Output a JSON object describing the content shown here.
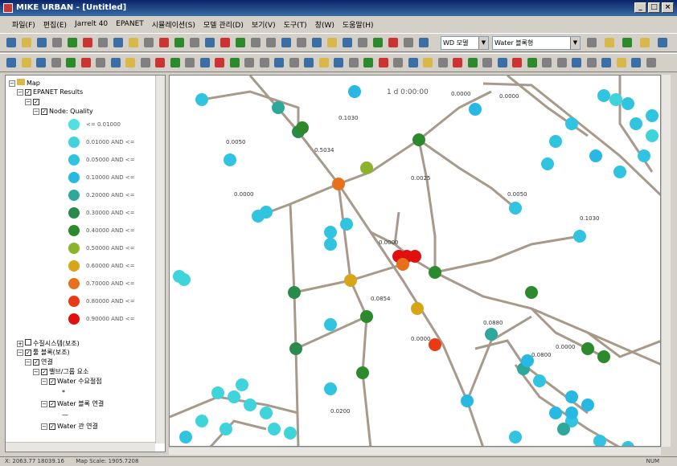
{
  "window": {
    "title": "MIKE URBAN - [Untitled]"
  },
  "menu": [
    "파일(F)",
    "편집(E)",
    "Jarrelt 40",
    "EPANET",
    "시뮬레이션(S)",
    "모델 관리(D)",
    "보기(V)",
    "도구(T)",
    "창(W)",
    "도움말(H)"
  ],
  "toolbar": {
    "combo1": "WD 모델",
    "combo2": "Water 블록형"
  },
  "tree": {
    "root": "Map",
    "results": "EPANET Results",
    "subgroup": "",
    "node_label": "Node: Quality",
    "legend": [
      {
        "label": "<= 0.01000",
        "color": "#4fe0e0"
      },
      {
        "label": "0.01000 AND <=",
        "color": "#3fd4dc"
      },
      {
        "label": "0.05000 AND <=",
        "color": "#30c4e0"
      },
      {
        "label": "0.10000 AND <=",
        "color": "#27b8e4"
      },
      {
        "label": "0.20000 AND <=",
        "color": "#2da89a"
      },
      {
        "label": "0.30000 AND <=",
        "color": "#2a8a4a"
      },
      {
        "label": "0.40000 AND <=",
        "color": "#2c8a2c"
      },
      {
        "label": "0.50000 AND <=",
        "color": "#8cb42a"
      },
      {
        "label": "0.60000 AND <=",
        "color": "#d8a418"
      },
      {
        "label": "0.70000 AND <=",
        "color": "#e8701a"
      },
      {
        "label": "0.80000 AND <=",
        "color": "#e83a14"
      },
      {
        "label": "0.90000 AND <=",
        "color": "#e01010"
      }
    ],
    "group2": "수질시스템(보조)",
    "group3": "툴 블록(보조)",
    "group4": "연결",
    "group5": "밸브/그룹 요소",
    "item1": "Water 수요절점",
    "item2": "Water 블록 연결",
    "item3": "Water 관 연결",
    "star": "*",
    "dash": "—"
  },
  "map": {
    "time_label": "1 d 0:00:00",
    "pipe_color": "#a89a8a",
    "node_labels": [
      "0.0000",
      "0.0000",
      "0.0050",
      "0.5034",
      "0.1030",
      "0.0025",
      "0.0050",
      "0.1030",
      "0.0000",
      "0.0000",
      "0.0854",
      "0.0000",
      "0.0000",
      "0.0880",
      "0.0800",
      "0.0200"
    ]
  },
  "status": {
    "coords": "X: 2063.77  18039.16",
    "scale": "Map Scale: 1905.7208",
    "right": "NUM"
  }
}
